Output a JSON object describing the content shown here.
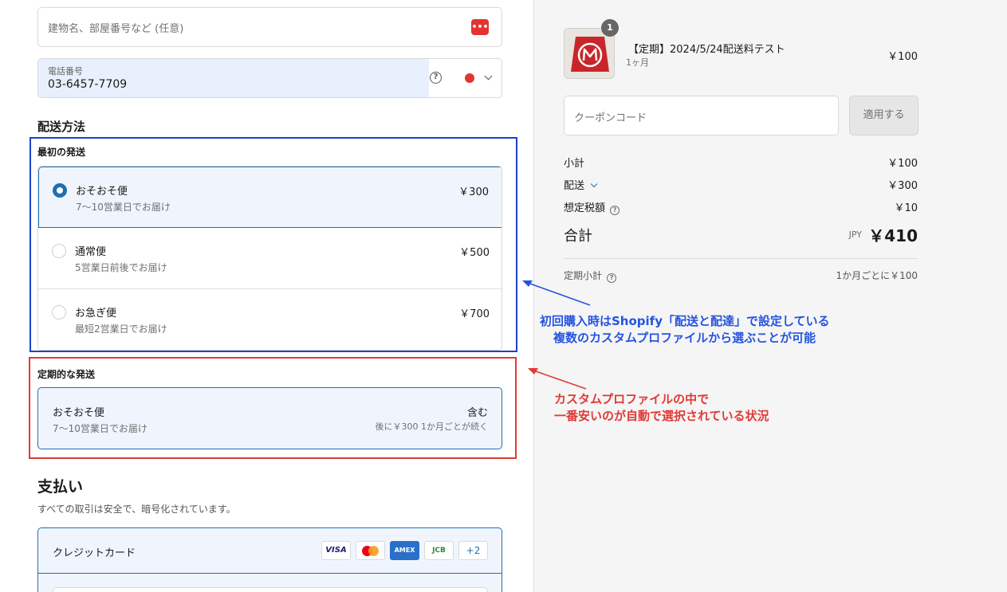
{
  "address": {
    "line2_placeholder": "建物名、部屋番号など (任意)",
    "autofill_icon": "•••"
  },
  "phone": {
    "label": "電話番号",
    "value": "03-6457-7709",
    "help": "?"
  },
  "shipping": {
    "title": "配送方法",
    "first_title": "最初の発送",
    "options": [
      {
        "name": "おそおそ便",
        "desc": "7〜10営業日でお届け",
        "price": "￥300",
        "selected": true
      },
      {
        "name": "通常便",
        "desc": "5営業日前後でお届け",
        "price": "￥500",
        "selected": false
      },
      {
        "name": "お急ぎ便",
        "desc": "最短2営業日でお届け",
        "price": "￥700",
        "selected": false
      }
    ],
    "recurring_title": "定期的な発送",
    "recurring": {
      "name": "おそおそ便",
      "desc": "7〜10営業日でお届け",
      "price": "含む",
      "note": "後に￥300 1か月ごとが続く"
    }
  },
  "annotations": {
    "blue_line1": "初回購入時はShopify「配送と配達」で設定している",
    "blue_line2": "複数のカスタムプロファイルから選ぶことが可能",
    "red_line1": "カスタムプロファイルの中で",
    "red_line2": "一番安いのが自動で選択されている状況",
    "blue_color": "#2554e0",
    "red_color": "#e03a36"
  },
  "payment": {
    "title": "支払い",
    "subtitle": "すべての取引は安全で、暗号化されています。",
    "method": "クレジットカード",
    "cards": [
      "VISA",
      "mastercard-icon",
      "AMEX",
      "JCB",
      "+2"
    ]
  },
  "order": {
    "product_name": "【定期】2024/5/24配送料テスト",
    "product_sub": "1ヶ月",
    "product_price": "￥100",
    "quantity": "1",
    "coupon_placeholder": "クーポンコード",
    "apply_label": "適用する",
    "subtotal_label": "小計",
    "subtotal": "￥100",
    "shipping_label": "配送",
    "shipping": "￥300",
    "tax_label": "想定税額",
    "tax": "￥10",
    "total_label": "合計",
    "currency": "JPY",
    "total": "￥410",
    "recurring_label": "定期小計",
    "recurring_value": "1か月ごとに￥100"
  },
  "colors": {
    "accent": "#1f6fb0",
    "selected_bg": "#f0f5fd",
    "sidebar_bg": "#f5f5f5"
  }
}
